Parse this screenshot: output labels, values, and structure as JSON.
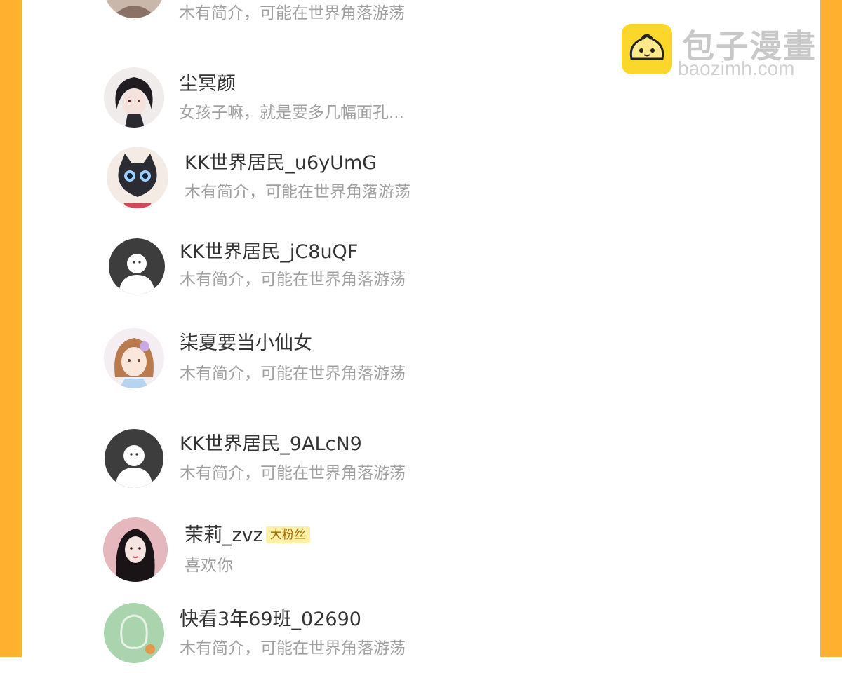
{
  "watermark": {
    "cn": "包子漫畫",
    "en": "baozimh.com"
  },
  "colors": {
    "side_bar": "#ffb02e",
    "name": "#333333",
    "bio": "#a0a0a0",
    "badge_bg": "#fff0a8",
    "badge_text": "#a06b00"
  },
  "users": [
    {
      "name": "",
      "bio": "木有简介，可能在世界角落游荡",
      "avatar": "photo-avatar"
    },
    {
      "name": "尘冥颜",
      "bio": "女孩子嘛，就是要多几幅面孔...",
      "avatar": "anime-boy-avatar"
    },
    {
      "name": "KK世界居民_u6yUmG",
      "bio": "木有简介，可能在世界角落游荡",
      "avatar": "black-cat-avatar"
    },
    {
      "name": "KK世界居民_jC8uQF",
      "bio": "木有简介，可能在世界角落游荡",
      "avatar": "default-avatar"
    },
    {
      "name": "柒夏要当小仙女",
      "bio": "木有简介，可能在世界角落游荡",
      "avatar": "anime-girl-avatar"
    },
    {
      "name": "KK世界居民_9ALcN9",
      "bio": "木有简介，可能在世界角落游荡",
      "avatar": "default-avatar"
    },
    {
      "name": "茉莉_zvz",
      "bio": "喜欢你",
      "badge": "大粉丝",
      "avatar": "dark-hair-girl-avatar"
    },
    {
      "name": "快看3年69班_02690",
      "bio": "木有简介，可能在世界角落游荡",
      "avatar": "green-avatar"
    }
  ]
}
